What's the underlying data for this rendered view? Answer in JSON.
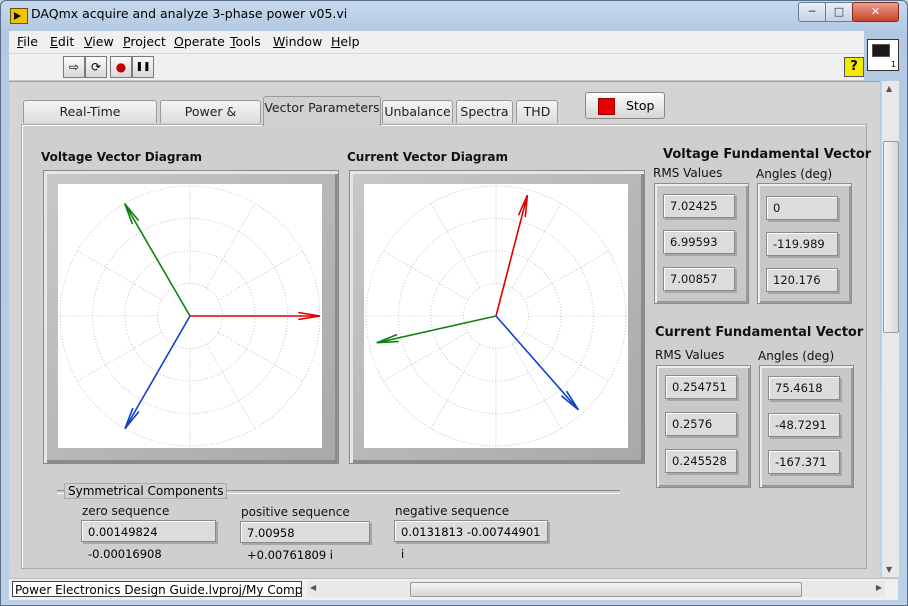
{
  "window": {
    "title": "DAQmx acquire and analyze 3-phase power v05.vi",
    "min_glyph": "─",
    "max_glyph": "□",
    "close_glyph": "✕"
  },
  "menu": [
    "File",
    "Edit",
    "View",
    "Project",
    "Operate",
    "Tools",
    "Window",
    "Help"
  ],
  "toolbar": {
    "run_glyph": "⇨",
    "run_cont_glyph": "⟳",
    "abort_glyph": "●",
    "pause_glyph": "❚❚",
    "help_glyph": "?"
  },
  "vi_icon": {
    "number": "1"
  },
  "tabs": [
    {
      "label": "Real-Time Waveforms"
    },
    {
      "label": "Power & Energy"
    },
    {
      "label": "Vector Parameters"
    },
    {
      "label": "Unbalance"
    },
    {
      "label": "Spectra"
    },
    {
      "label": "THD"
    }
  ],
  "stop_button": {
    "label": "Stop"
  },
  "voltage_graph": {
    "title": "Voltage Vector Diagram",
    "vectors": [
      {
        "color": "#e00000",
        "angle_deg": 0,
        "magnitude": 1.0
      },
      {
        "color": "#1040c8",
        "angle_deg": -119.989,
        "magnitude": 1.0
      },
      {
        "color": "#108010",
        "angle_deg": 120.176,
        "magnitude": 1.0
      }
    ]
  },
  "current_graph": {
    "title": "Current Vector Diagram",
    "vectors": [
      {
        "color": "#e00000",
        "angle_deg": 75.4618,
        "magnitude": 0.96
      },
      {
        "color": "#1040c8",
        "angle_deg": -48.7291,
        "magnitude": 0.96
      },
      {
        "color": "#108010",
        "angle_deg": -167.371,
        "magnitude": 0.94
      }
    ]
  },
  "voltage_fundamental": {
    "title": "Voltage Fundamental Vector",
    "rms_label": "RMS Values",
    "angles_label": "Angles (deg)",
    "rms": [
      "7.02425",
      "6.99593",
      "7.00857"
    ],
    "angles": [
      "0",
      "-119.989",
      "120.176"
    ]
  },
  "current_fundamental": {
    "title": "Current Fundamental Vector",
    "rms_label": "RMS Values",
    "angles_label": "Angles (deg)",
    "rms": [
      "0.254751",
      "0.2576",
      "0.245528"
    ],
    "angles": [
      "75.4618",
      "-48.7291",
      "-167.371"
    ]
  },
  "symmetrical": {
    "title": "Symmetrical Components",
    "zero_label": "zero sequence",
    "zero_value": "0.00149824 -0.00016908",
    "positive_label": "positive sequence",
    "positive_value": "7.00958 +0.00761809 i",
    "negative_label": "negative sequence",
    "negative_value": "0.0131813 -0.00744901 i"
  },
  "status": {
    "path": "Power Electronics Design Guide.lvproj/My Computer"
  }
}
